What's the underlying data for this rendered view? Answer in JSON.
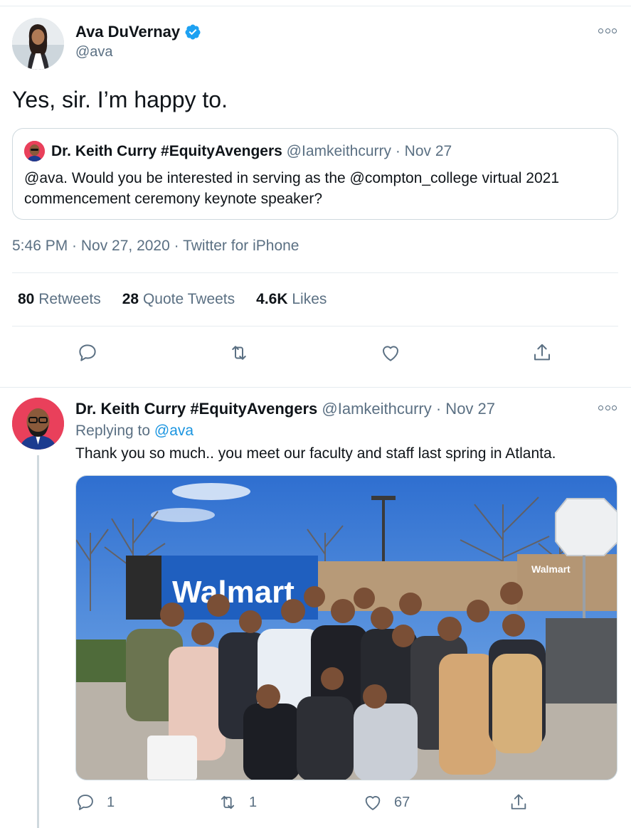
{
  "main_tweet": {
    "author_name": "Ava DuVernay",
    "author_handle": "@ava",
    "text": "Yes, sir. I’m happy to.",
    "timestamp": "5:46 PM · Nov 27, 2020 · ",
    "source": "Twitter for iPhone",
    "quote": {
      "name": "Dr. Keith Curry #EquityAvengers",
      "handle_date": " @Iamkeithcurry · Nov 27",
      "text": "@ava. Would you be interested in serving as the @compton_college virtual 2021 commencement ceremony keynote speaker?"
    },
    "stats": {
      "retweets_count": "80",
      "retweets_label": "Retweets",
      "quotes_count": "28",
      "quotes_label": "Quote Tweets",
      "likes_count": "4.6K",
      "likes_label": "Likes"
    }
  },
  "reply_tweet": {
    "author_name": "Dr. Keith Curry #EquityAvengers",
    "handle_date": " @Iamkeithcurry · Nov 27",
    "replying_prefix": "Replying to ",
    "replying_to": "@ava",
    "text": "Thank you so much.. you meet our faculty and staff last spring in Atlanta.",
    "photo_sign": "Walmart",
    "reply_count": "1",
    "retweet_count": "1",
    "like_count": "67"
  },
  "colors": {
    "text": "#0f1419",
    "secondary": "#5b7083",
    "link": "#1b95e0",
    "border": "#cfd9de",
    "verified": "#1da1f2"
  }
}
